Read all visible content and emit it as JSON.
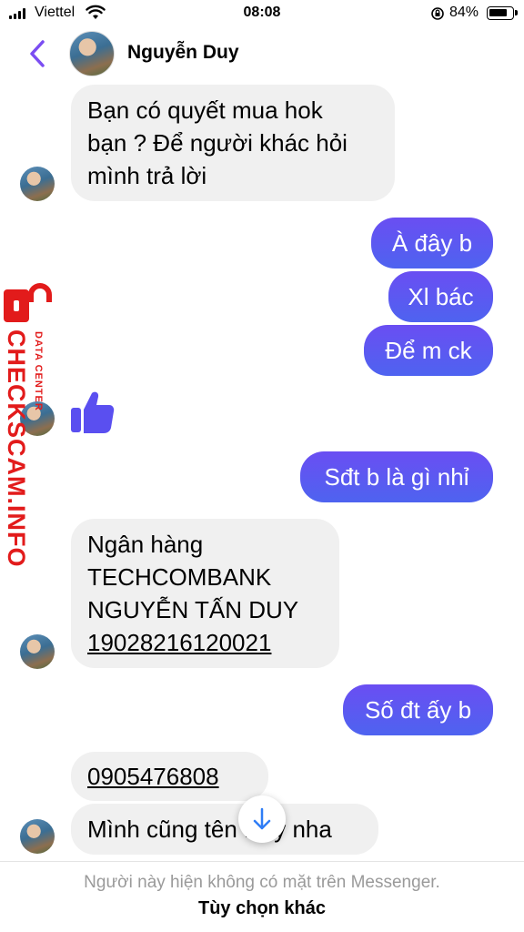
{
  "status_bar": {
    "carrier": "Viettel",
    "time": "08:08",
    "battery_percent": "84%",
    "battery_level": 0.84
  },
  "header": {
    "contact_name": "Nguyễn Duy"
  },
  "messages": [
    {
      "from": "contact",
      "lines": [
        "Bạn có quyết mua hok",
        "bạn ? Để người khác hỏi",
        "mình trả lời"
      ]
    },
    {
      "from": "me",
      "text": "À đây b"
    },
    {
      "from": "me",
      "text": "Xl bác"
    },
    {
      "from": "me",
      "text": "Để m ck"
    },
    {
      "from": "contact",
      "type": "like",
      "icon": "thumbs-up-icon"
    },
    {
      "from": "me",
      "text": "Sđt b là gì nhỉ"
    },
    {
      "from": "contact",
      "lines": [
        "Ngân hàng",
        "TECHCOMBANK",
        "NGUYỄN TẤN DUY",
        "19028216120021"
      ]
    },
    {
      "from": "me",
      "text": "Số đt ấy b"
    },
    {
      "from": "contact",
      "text": "0905476808"
    },
    {
      "from": "contact",
      "text": "Mình cũng tên Duy nha"
    }
  ],
  "watermark": {
    "main": "CHECKSCAM.INFO",
    "sub": "DATA CENTER",
    "color": "#e21b1b"
  },
  "footer": {
    "note": "Người này hiện không có mặt trên Messenger.",
    "link": "Tùy chọn khác"
  },
  "colors": {
    "accent": "#7b4df2",
    "outgoing_bubble": "#5a59f1",
    "incoming_bubble": "#f0f0f0"
  }
}
